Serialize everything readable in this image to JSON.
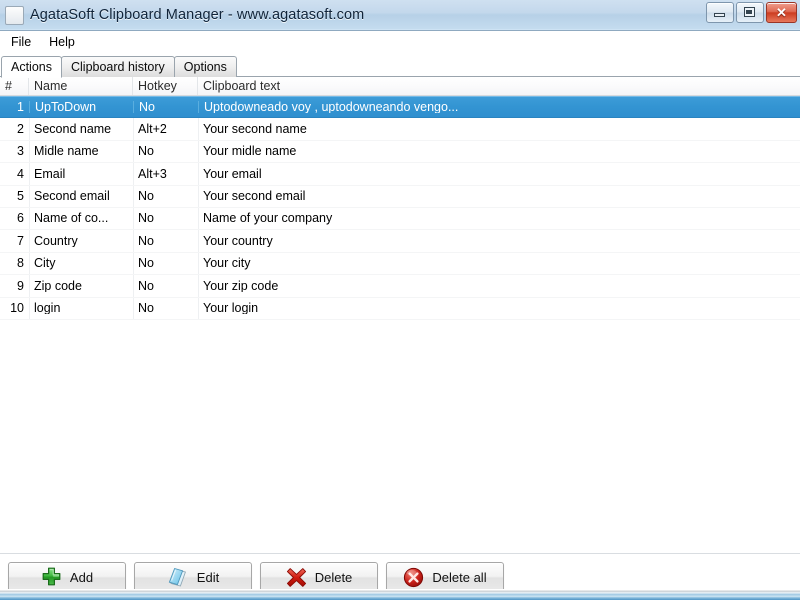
{
  "window": {
    "title": "AgataSoft Clipboard Manager - www.agatasoft.com",
    "icon": "app-icon",
    "controls": [
      {
        "name": "minimize-button",
        "glyph": "minimize-icon",
        "label": "Minimize"
      },
      {
        "name": "maximize-button",
        "glyph": "maximize-icon",
        "label": "Maximize"
      },
      {
        "name": "close-button",
        "glyph": "close-icon",
        "label": "✕"
      }
    ]
  },
  "menu": {
    "items": [
      {
        "label": "File"
      },
      {
        "label": "Help"
      }
    ]
  },
  "tabs": {
    "active": "Actions",
    "items": [
      {
        "label": "Actions",
        "active": true
      },
      {
        "label": "Clipboard history",
        "active": false
      },
      {
        "label": "Options",
        "active": false
      }
    ]
  },
  "list": {
    "columns": [
      {
        "key": "num",
        "label": "#"
      },
      {
        "key": "name",
        "label": "Name"
      },
      {
        "key": "hotkey",
        "label": "Hotkey"
      },
      {
        "key": "text",
        "label": "Clipboard text"
      }
    ],
    "selected_row_index": 0,
    "rows": [
      {
        "num": "1",
        "name": "UpToDown",
        "hotkey": "No",
        "text": "Uptodowneado voy , uptodowneando vengo..."
      },
      {
        "num": "2",
        "name": "Second name",
        "hotkey": "Alt+2",
        "text": "Your second name"
      },
      {
        "num": "3",
        "name": "Midle name",
        "hotkey": "No",
        "text": "Your midle name"
      },
      {
        "num": "4",
        "name": "Email",
        "hotkey": "Alt+3",
        "text": "Your email"
      },
      {
        "num": "5",
        "name": "Second email",
        "hotkey": "No",
        "text": "Your second email"
      },
      {
        "num": "6",
        "name": "Name of co...",
        "hotkey": "No",
        "text": "Name of your company"
      },
      {
        "num": "7",
        "name": "Country",
        "hotkey": "No",
        "text": "Your country"
      },
      {
        "num": "8",
        "name": "City",
        "hotkey": "No",
        "text": "Your city"
      },
      {
        "num": "9",
        "name": "Zip code",
        "hotkey": "No",
        "text": "Your zip code"
      },
      {
        "num": "10",
        "name": "login",
        "hotkey": "No",
        "text": "Your login"
      }
    ]
  },
  "buttons": [
    {
      "name": "add-button",
      "label": "Add",
      "icon": "green-plus-icon"
    },
    {
      "name": "edit-button",
      "label": "Edit",
      "icon": "blue-book-icon"
    },
    {
      "name": "delete-button",
      "label": "Delete",
      "icon": "red-x-icon"
    },
    {
      "name": "delete-all-button",
      "label": "Delete all",
      "icon": "red-circle-x-icon"
    }
  ],
  "colors": {
    "titlebar": "#bcd4ea",
    "selection": "#3394d2",
    "close_button": "#cc3d22",
    "add_icon": "#2aa02a",
    "edit_icon": "#6fc2e8",
    "delete_icon": "#cc1111",
    "delete_all_icon": "#c21b1b"
  }
}
